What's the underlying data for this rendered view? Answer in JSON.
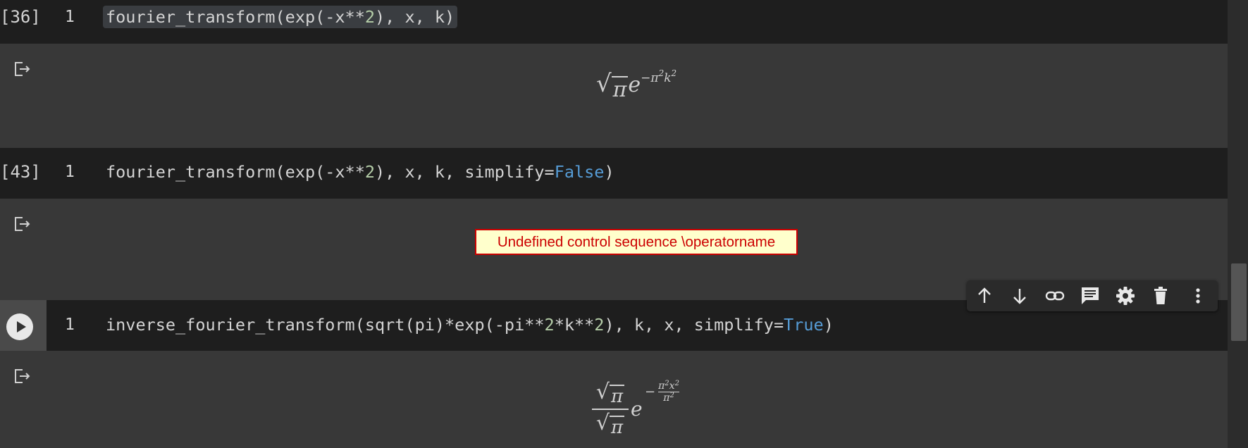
{
  "cells": [
    {
      "exec_count": "[36]",
      "line_number": "1",
      "code_parts": [
        "fourier_transform(exp(-x**",
        "2",
        "), x, k)"
      ],
      "output_math": {
        "coef": "π",
        "base": "e",
        "exp": "−π",
        "exp_sq": "2",
        "exp_var": "k",
        "exp_var_sq": "2"
      }
    },
    {
      "exec_count": "[43]",
      "line_number": "1",
      "code_parts": [
        "fourier_transform(exp(-x**",
        "2",
        "), x, k, simplify=",
        "False",
        ")"
      ],
      "output_error": "Undefined control sequence \\operatorname"
    },
    {
      "line_number": "1",
      "code_parts": [
        "inverse_fourier_transform(sqrt(pi)*exp(-pi**",
        "2",
        "*k**",
        "2",
        "), k, x, simplify=",
        "True",
        ")"
      ],
      "output_math": {
        "num": "π",
        "den": "π",
        "base": "e",
        "minus": "−",
        "exp_num": "π",
        "exp_num_sq": "2",
        "exp_num_var": "x",
        "exp_num_var_sq": "2",
        "exp_den": "π",
        "exp_den_sq": "2"
      }
    }
  ],
  "toolbar": [
    "move-up-icon",
    "move-down-icon",
    "link-icon",
    "comment-icon",
    "settings-icon",
    "delete-icon",
    "more-icon"
  ],
  "colors": {
    "background": "#383838",
    "code_background": "#1e1e1e",
    "number": "#b5cea8",
    "keyword": "#569cd6",
    "error": "#cc0000",
    "error_background": "#ffffcc"
  }
}
